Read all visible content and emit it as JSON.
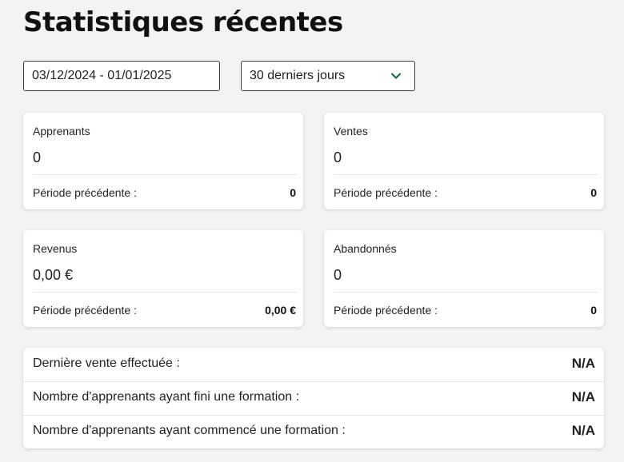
{
  "page": {
    "title": "Statistiques récentes"
  },
  "filters": {
    "date_range": "03/12/2024 - 01/01/2025",
    "period": "30 derniers jours",
    "period_icon": "chevron-down-icon",
    "accent_color": "#1f6b46"
  },
  "cards": [
    {
      "label": "Apprenants",
      "value": "0",
      "previous_label": "Période précédente :",
      "previous_value": "0"
    },
    {
      "label": "Ventes",
      "value": "0",
      "previous_label": "Période précédente :",
      "previous_value": "0"
    },
    {
      "label": "Revenus",
      "value": "0,00 €",
      "previous_label": "Période précédente :",
      "previous_value": "0,00 €"
    },
    {
      "label": "Abandonnés",
      "value": "0",
      "previous_label": "Période précédente :",
      "previous_value": "0"
    }
  ],
  "summary": [
    {
      "label": "Dernière vente effectuée :",
      "value": "N/A"
    },
    {
      "label": "Nombre d'apprenants ayant fini une formation :",
      "value": "N/A"
    },
    {
      "label": "Nombre d'apprenants ayant commencé une formation :",
      "value": "N/A"
    }
  ]
}
